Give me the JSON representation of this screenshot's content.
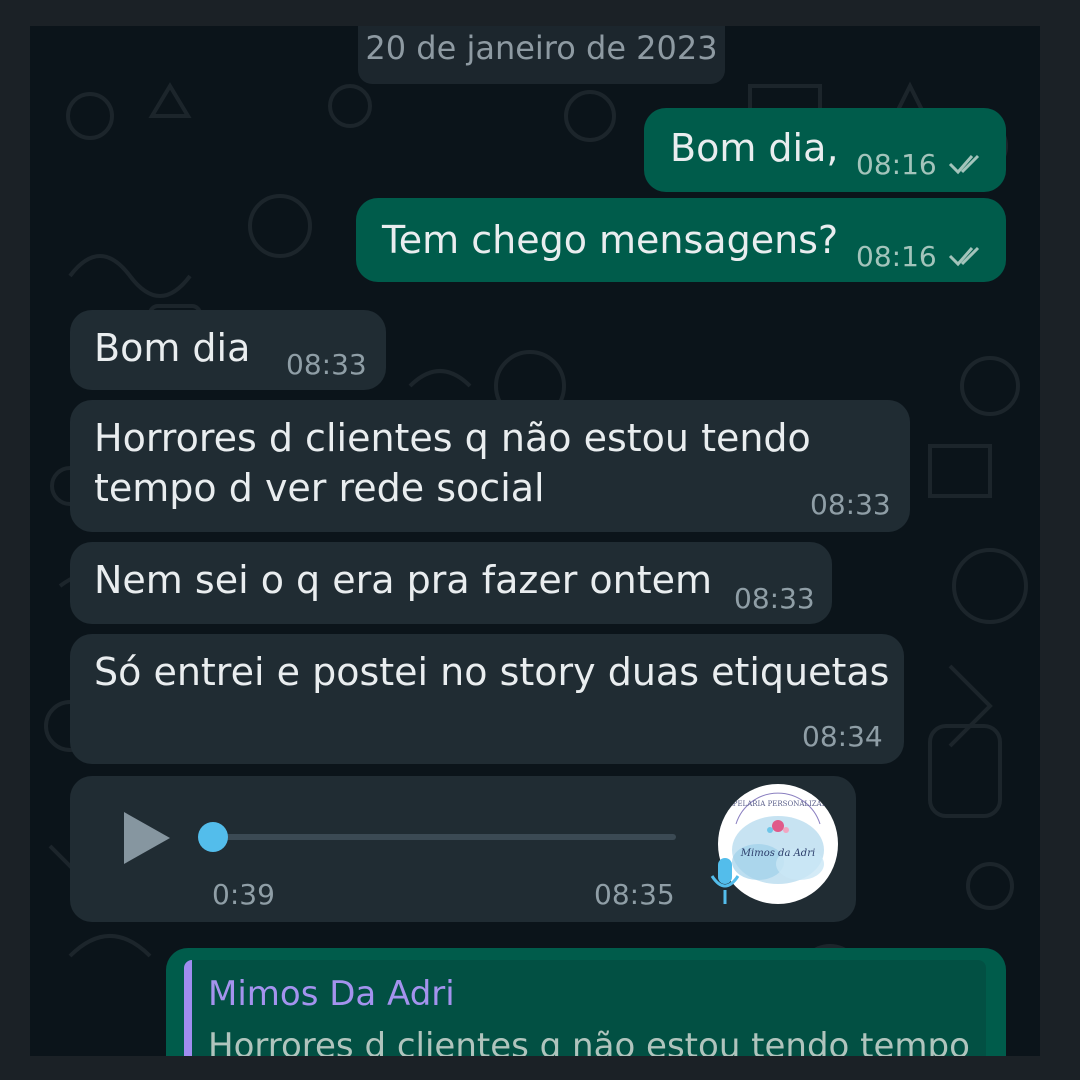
{
  "chat": {
    "date_chip": "20 de janeiro de 2023",
    "messages": [
      {
        "text": "Bom dia,",
        "time": "08:16",
        "status": "read"
      },
      {
        "text": "Tem chego mensagens?",
        "time": "08:16",
        "status": "read"
      },
      {
        "text": "Bom dia",
        "time": "08:33"
      },
      {
        "line1": "Horrores d clientes q não estou tendo",
        "line2": "tempo d ver rede social",
        "time": "08:33"
      },
      {
        "text": "Nem sei o q era pra fazer ontem",
        "time": "08:33"
      },
      {
        "text": "Só entrei e postei no story duas etiquetas",
        "time": "08:34"
      }
    ],
    "voice_note": {
      "duration": "0:39",
      "time": "08:35",
      "progress": 0,
      "avatar_brand": "Mimos da Adri",
      "avatar_tagline": "PAPELARIA PERSONALIZADA"
    },
    "reply": {
      "quoted_author": "Mimos Da Adri",
      "quoted_text": "Horrores d clientes q não estou tendo tempo"
    }
  },
  "colors": {
    "outgoing_bubble": "#005c4b",
    "incoming_bubble": "#202c33",
    "background": "#0b141a",
    "accent_blue": "#53bdeb",
    "quote_bar": "#a08df0"
  }
}
